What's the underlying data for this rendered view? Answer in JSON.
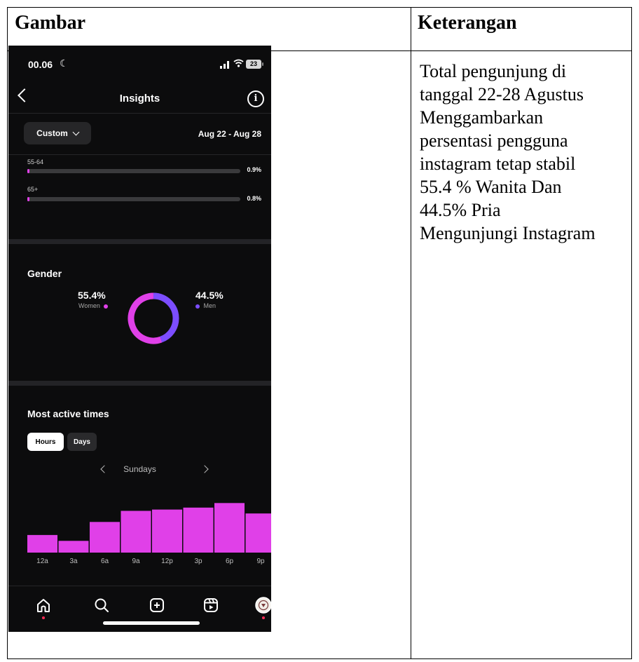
{
  "table": {
    "header_left": "Gambar",
    "header_right": "Keterangan",
    "description_lines": [
      "Total pengunjung di",
      "tanggal 22-28 Agustus",
      "Menggambarkan",
      "persentasi pengguna",
      "instagram tetap stabil",
      "55.4 % Wanita Dan",
      "44.5% Pria",
      "Mengunjungi Instagram"
    ]
  },
  "phone": {
    "status_bar": {
      "time": "00.06",
      "battery": "23"
    },
    "header": {
      "title": "Insights"
    },
    "filter": {
      "custom_label": "Custom",
      "date_range": "Aug 22 - Aug 28"
    },
    "age_ranges": [
      {
        "label": "55-64",
        "percent": "0.9%",
        "fill_fraction": 0.009
      },
      {
        "label": "65+",
        "percent": "0.8%",
        "fill_fraction": 0.008
      }
    ],
    "gender": {
      "title": "Gender",
      "women_percent": "55.4%",
      "women_label": "Women",
      "men_percent": "44.5%",
      "men_label": "Men",
      "women_color": "#e040e8",
      "men_color": "#7c4dff"
    },
    "most_active": {
      "title": "Most active times",
      "tab_hours": "Hours",
      "tab_days": "Days",
      "day": "Sundays"
    },
    "nav_icons": [
      "home-icon",
      "search-icon",
      "create-icon",
      "reels-icon",
      "profile-avatar"
    ]
  },
  "chart_data": {
    "type": "bar",
    "categories": [
      "12a",
      "3a",
      "6a",
      "9a",
      "12p",
      "3p",
      "6p",
      "9p"
    ],
    "values": [
      27,
      18,
      47,
      64,
      66,
      69,
      76,
      60
    ],
    "ylim": [
      0,
      100
    ],
    "bar_color": "#e040e8",
    "grid": false
  }
}
